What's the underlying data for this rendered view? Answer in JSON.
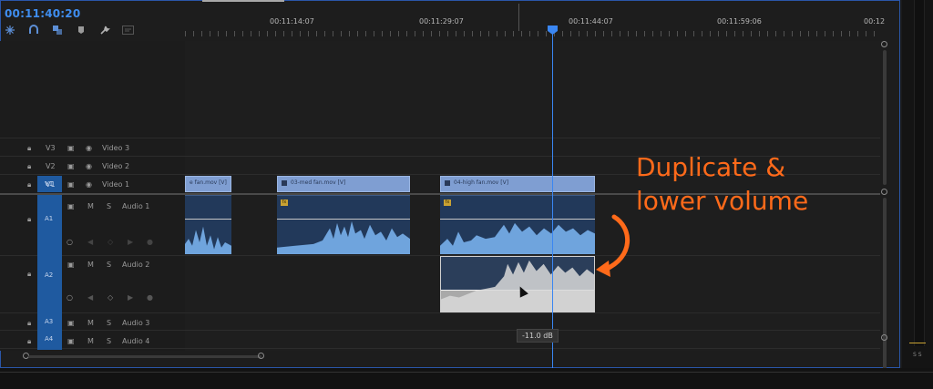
{
  "timeline": {
    "timecode": "00:11:40:20",
    "ruler_labels": [
      "00:11:14:07",
      "00:11:29:07",
      "00:11:44:07",
      "00:11:59:06",
      "00:12"
    ],
    "tools": [
      "snap-icon",
      "magnet-icon",
      "linked-selection-icon",
      "marker-icon",
      "wrench-icon",
      "captions-icon"
    ]
  },
  "tracks": {
    "v3": {
      "id": "V3",
      "name": "Video 3"
    },
    "v2": {
      "id": "V2",
      "name": "Video 2"
    },
    "v1": {
      "id": "V1",
      "name": "Video 1",
      "target": "V1"
    },
    "a1": {
      "id": "A1",
      "name": "Audio 1",
      "m": "M",
      "s": "S"
    },
    "a2": {
      "id": "A2",
      "name": "Audio 2",
      "m": "M",
      "s": "S"
    },
    "a3": {
      "id": "A3",
      "name": "Audio 3",
      "m": "M",
      "s": "S"
    },
    "a4": {
      "id": "A4",
      "name": "Audio 4",
      "m": "M",
      "s": "S"
    }
  },
  "clips": {
    "video": [
      {
        "label": "e fan.mov [V]"
      },
      {
        "label": "03-med fan.mov [V]"
      },
      {
        "label": "04-high fan.mov [V]"
      }
    ],
    "fx_badge": "fx"
  },
  "tooltip": "-11.0 dB",
  "meter_label": "S S",
  "annotation": {
    "line1": "Duplicate &",
    "line2": "lower volume"
  },
  "colors": {
    "accent": "#3a86f2",
    "annotation": "#ff6a1a",
    "video_clip": "#7f9ed2",
    "audio_clip": "#22395a"
  }
}
